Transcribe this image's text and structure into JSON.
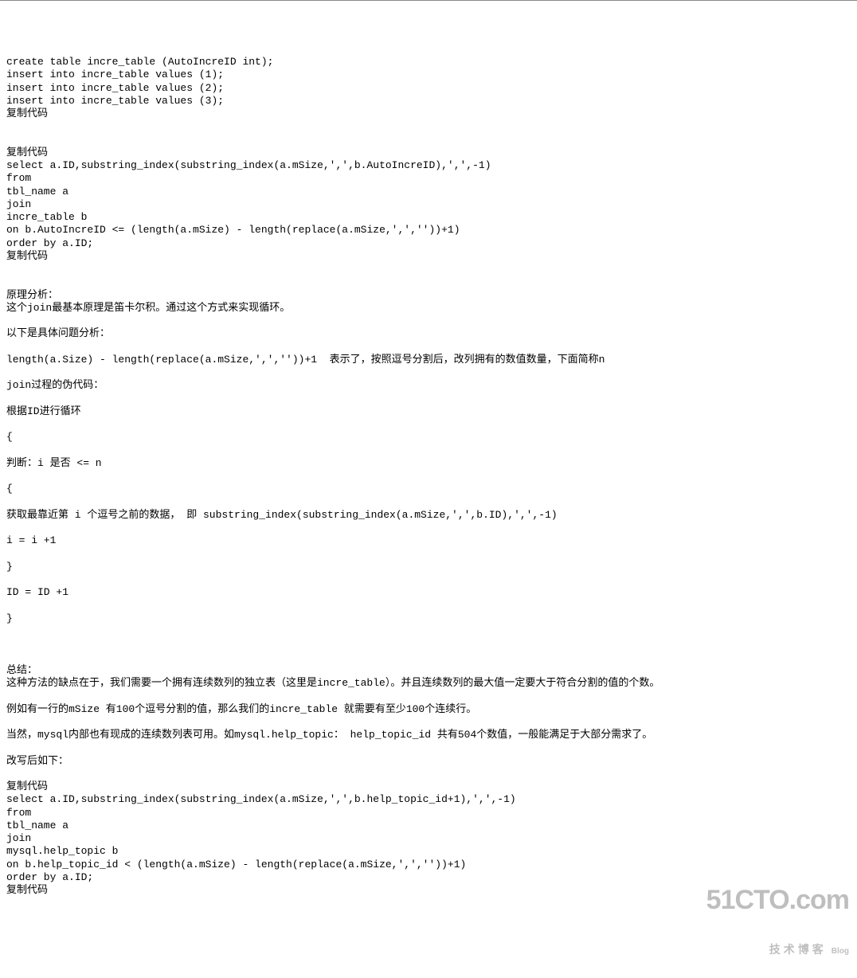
{
  "code1": {
    "l0": "create table incre_table (AutoIncreID int);",
    "l1": "insert into incre_table values (1);",
    "l2": "insert into incre_table values (2);",
    "l3": "insert into incre_table values (3);",
    "l4": "复制代码"
  },
  "code2": {
    "l0": "复制代码",
    "l1": "select a.ID,substring_index(substring_index(a.mSize,',',b.AutoIncreID),',',-1) ",
    "l2": "from ",
    "l3": "tbl_name a",
    "l4": "join",
    "l5": "incre_table b",
    "l6": "on b.AutoIncreID <= (length(a.mSize) - length(replace(a.mSize,',',''))+1)",
    "l7": "order by a.ID;",
    "l8": "复制代码"
  },
  "analysis": {
    "l0": "原理分析：",
    "l1": "这个join最基本原理是笛卡尔积。通过这个方式来实现循环。",
    "l2": "以下是具体问题分析：",
    "l3": "length(a.Size) - length(replace(a.mSize,',',''))+1  表示了，按照逗号分割后，改列拥有的数值数量，下面简称n",
    "l4": "join过程的伪代码：",
    "l5": "根据ID进行循环",
    "l6": "{",
    "l7": "判断：i 是否 <= n",
    "l8": "{",
    "l9": "获取最靠近第 i 个逗号之前的数据， 即 substring_index(substring_index(a.mSize,',',b.ID),',',-1)",
    "l10": "i = i +1 ",
    "l11": "}",
    "l12": "ID = ID +1 ",
    "l13": "}"
  },
  "summary": {
    "l0": "总结：",
    "l1": "这种方法的缺点在于，我们需要一个拥有连续数列的独立表（这里是incre_table）。并且连续数列的最大值一定要大于符合分割的值的个数。",
    "l2": "例如有一行的mSize 有100个逗号分割的值，那么我们的incre_table 就需要有至少100个连续行。",
    "l3": "当然，mysql内部也有现成的连续数列表可用。如mysql.help_topic： help_topic_id 共有504个数值，一般能满足于大部分需求了。",
    "l4": "改写后如下："
  },
  "code3": {
    "l0": "复制代码",
    "l1": "select a.ID,substring_index(substring_index(a.mSize,',',b.help_topic_id+1),',',-1) ",
    "l2": "from ",
    "l3": "tbl_name a",
    "l4": "join",
    "l5": "mysql.help_topic b",
    "l6": "on b.help_topic_id < (length(a.mSize) - length(replace(a.mSize,',',''))+1)",
    "l7": "order by a.ID;",
    "l8": "复制代码"
  },
  "watermark": {
    "big": "51CTO.com",
    "sub": "技术博客",
    "tag": "Blog"
  }
}
